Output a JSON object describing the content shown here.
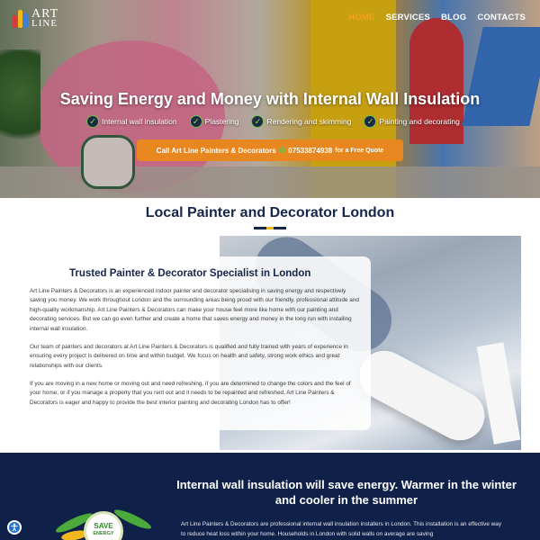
{
  "brand": {
    "logo_line1": "ART",
    "logo_line2": "LINE"
  },
  "nav": [
    {
      "label": "HOME",
      "active": true
    },
    {
      "label": "SERVICES",
      "active": false
    },
    {
      "label": "BLOG",
      "active": false
    },
    {
      "label": "CONTACTS",
      "active": false
    }
  ],
  "hero": {
    "title": "Saving Energy and Money with Internal Wall Insulation",
    "features": [
      "Internal wall insulation",
      "Plastering",
      "Rendering and skimming",
      "Painting and decorating"
    ],
    "cta": {
      "prefix": "Call Art Line Painters & Decorators",
      "phone_icon": "phone-icon",
      "phone": "07533874938",
      "suffix": "for a Free Quote"
    }
  },
  "section1": {
    "title": "Local Painter and Decorator London",
    "card_title": "Trusted Painter & Decorator Specialist in London",
    "paragraphs": [
      "Art Line Painters & Decorators is an experienced indoor painter and decorator specialising in saving energy and respectively saving you money. We work throughout London and the surrounding areas being proud with our friendly, professional attitude and high-quality workmanship. Art Line Painters & Decorators can make your house feel more like home with our painting and decorating services. But we can go even further and create a home that saves energy and money in the long run with installing internal wall insulation.",
      "Our team of painters and decorators at Art Line Painters & Decorators is qualified and fully trained with years of experience in ensuring every project is delivered on time and within budget. We focus on health and safety, strong work ethics and great relationships with our clients.",
      "If you are moving in a new home or moving out and need refreshing, if you are determined to change the colors and the feel of your home, or if you manage a property that you rent out and it needs to be repainted and refreshed, Art Line Painters & Decorators is eager and happy to provide the best interior painting and decorating London has to offer!"
    ]
  },
  "section2": {
    "title": "Internal wall insulation will save energy. Warmer in the winter and cooler in the summer",
    "paragraph": "Art Line Painters & Decorators are professional internal wall insulation installers in London. This installation is an effective way to reduce heat loss within your home. Households in London with solid walls on average are saving",
    "badge_line1": "SAVE",
    "badge_line2": "ENERGY"
  },
  "colors": {
    "navy": "#16254a",
    "dark_band": "#0f2148",
    "accent_orange": "#e8861f",
    "nav_active": "#f2a21b",
    "check_green": "#6fc04a"
  }
}
